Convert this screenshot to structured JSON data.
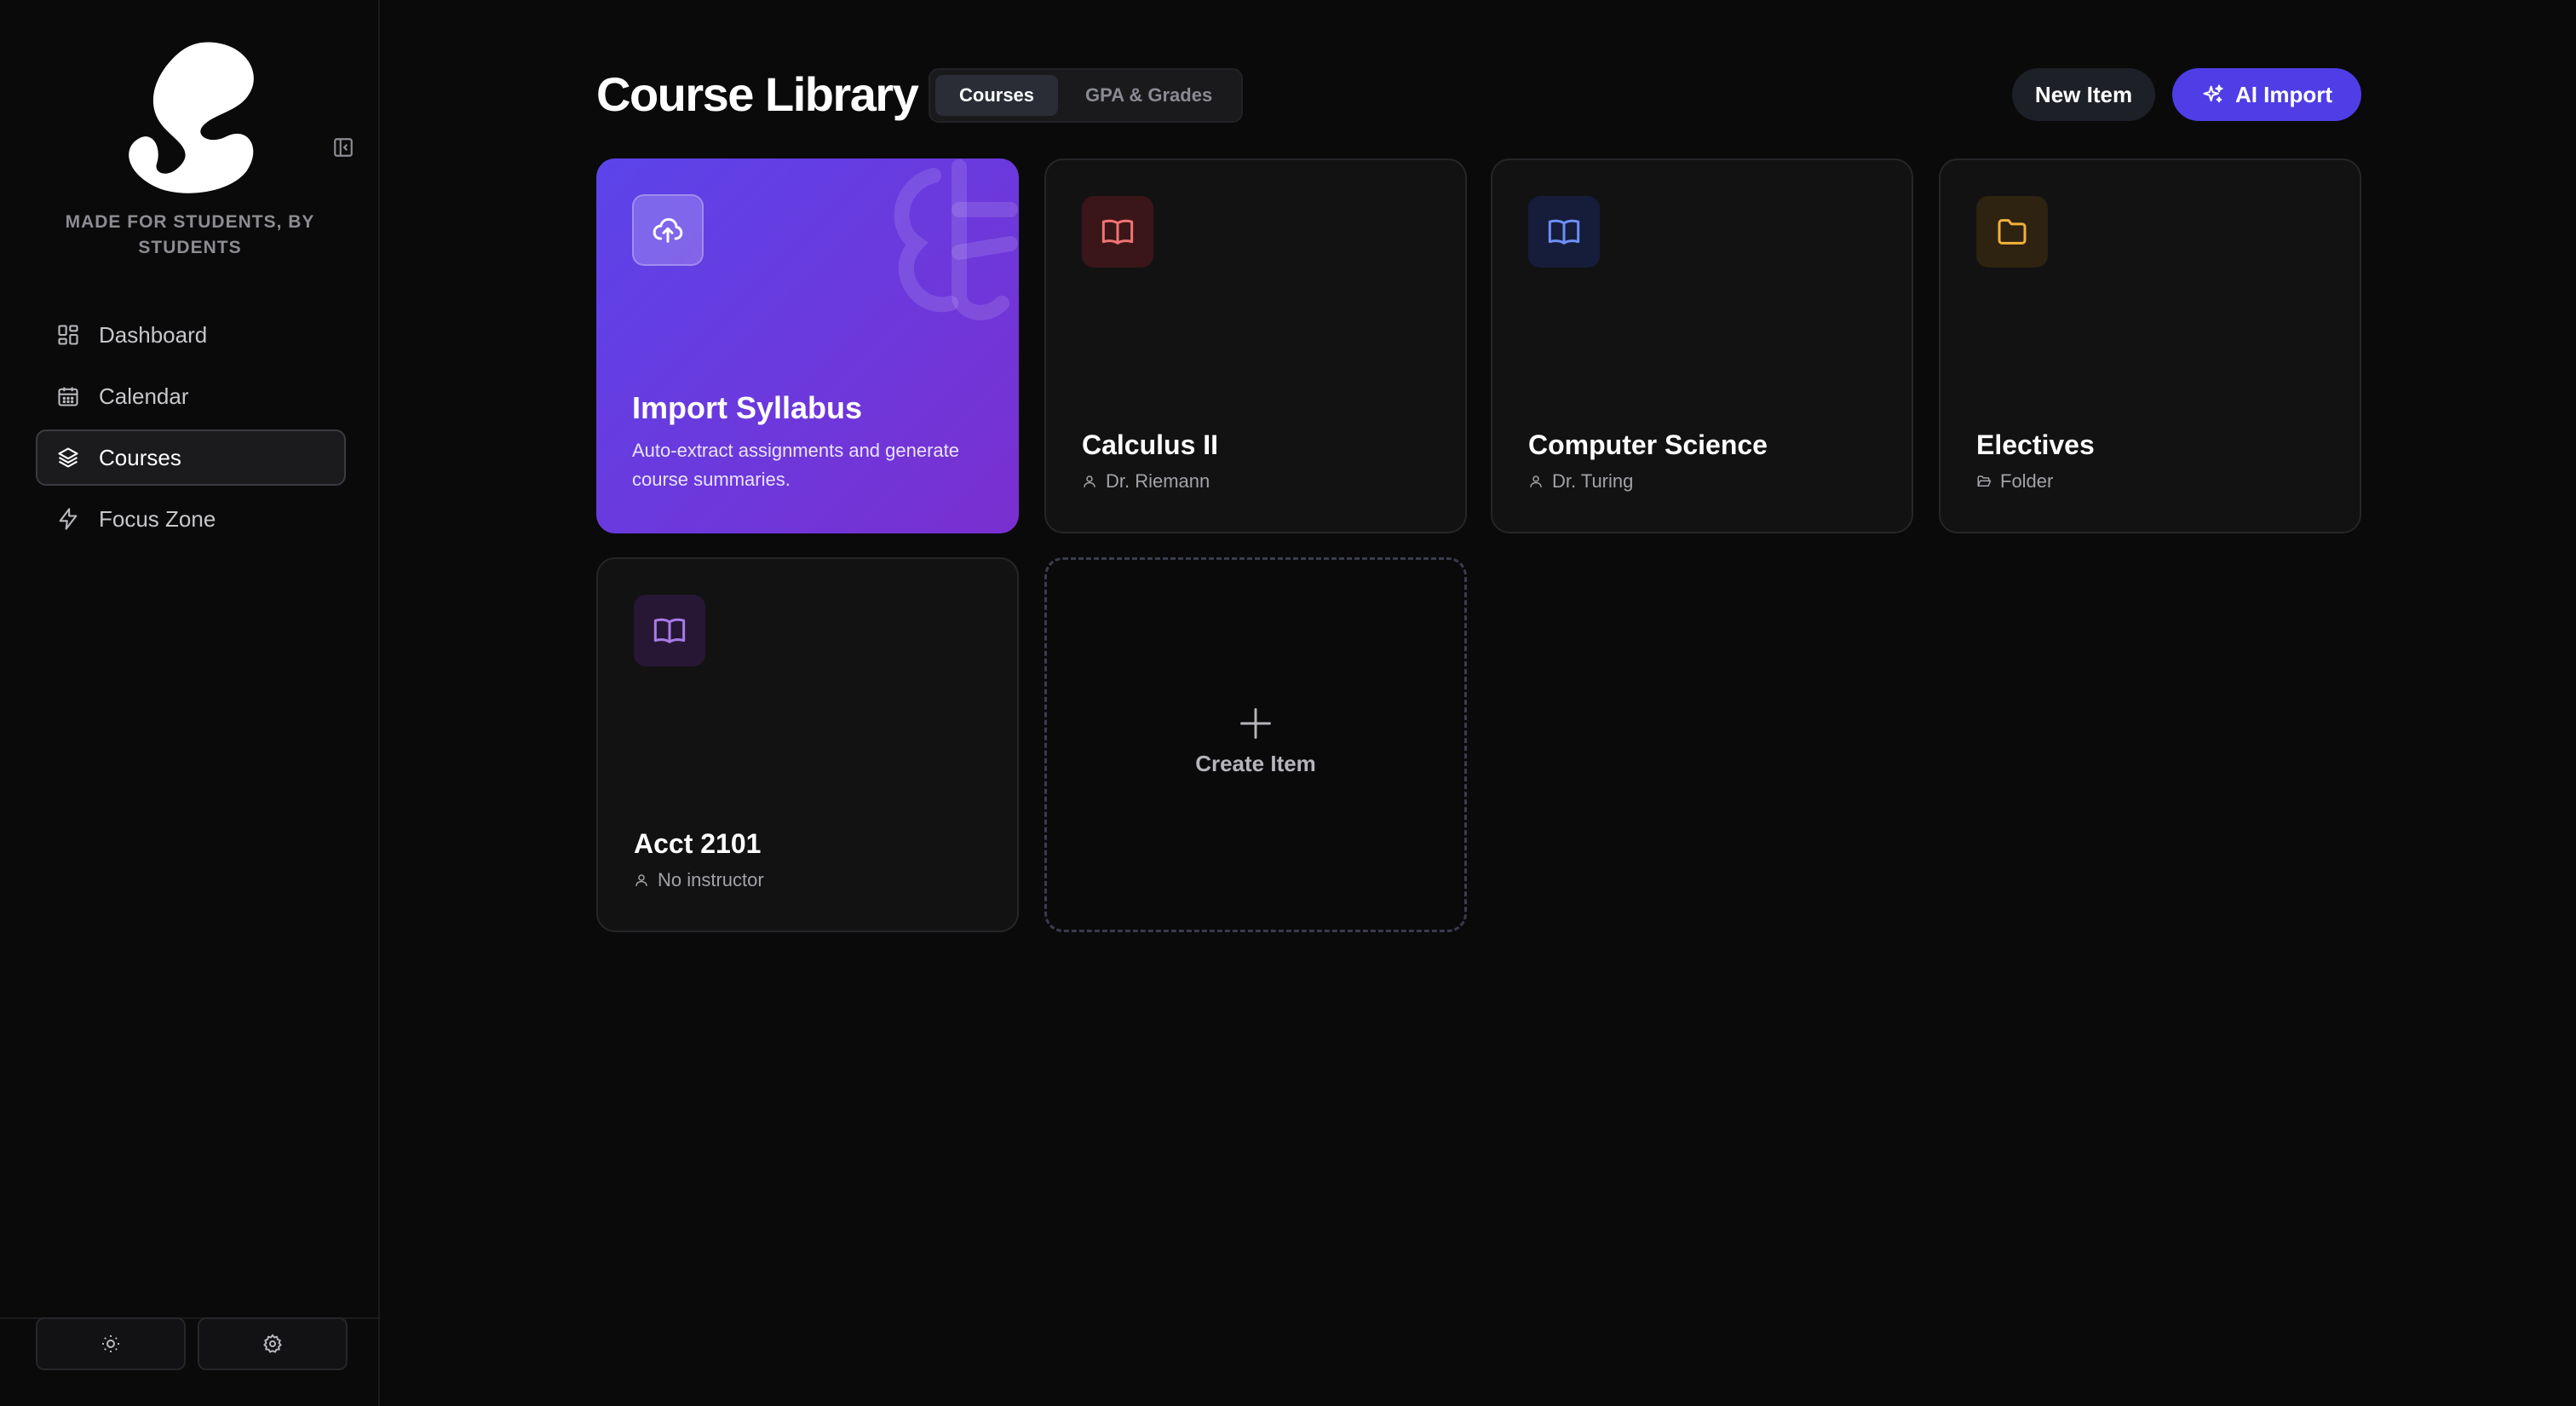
{
  "brand": {
    "tagline": "MADE FOR STUDENTS, BY STUDENTS",
    "logo_icon": "s-logo"
  },
  "sidebar": {
    "items": [
      {
        "label": "Dashboard",
        "icon": "dashboard-icon",
        "active": false
      },
      {
        "label": "Calendar",
        "icon": "calendar-icon",
        "active": false
      },
      {
        "label": "Courses",
        "icon": "layers-icon",
        "active": true
      },
      {
        "label": "Focus Zone",
        "icon": "lightning-icon",
        "active": false
      }
    ],
    "footer": [
      {
        "icon": "sun-icon"
      },
      {
        "icon": "gear-icon"
      }
    ]
  },
  "header": {
    "title": "Course Library",
    "tabs": [
      {
        "label": "Courses",
        "active": true
      },
      {
        "label": "GPA & Grades",
        "active": false
      }
    ],
    "new_item_label": "New Item",
    "ai_import_label": "AI Import"
  },
  "cards": {
    "import": {
      "title": "Import Syllabus",
      "description": "Auto-extract assignments and generate course summaries.",
      "icon": "cloud-upload-icon"
    },
    "items": [
      {
        "title": "Calculus II",
        "subtitle": "Dr. Riemann",
        "sub_icon": "user-icon",
        "icon": "book-icon",
        "accent": "#f07373"
      },
      {
        "title": "Computer Science",
        "subtitle": "Dr. Turing",
        "sub_icon": "user-icon",
        "icon": "book-icon",
        "accent": "#6d8ff5"
      },
      {
        "title": "Electives",
        "subtitle": "Folder",
        "sub_icon": "folder-icon",
        "icon": "folder-icon",
        "accent": "#f2b13a"
      },
      {
        "title": "Acct 2101",
        "subtitle": "No instructor",
        "sub_icon": "user-icon",
        "icon": "book-icon",
        "accent": "#a77be8"
      }
    ],
    "create_label": "Create Item"
  },
  "colors": {
    "accent": "#4f3ee6",
    "background": "#0a0a0b"
  }
}
